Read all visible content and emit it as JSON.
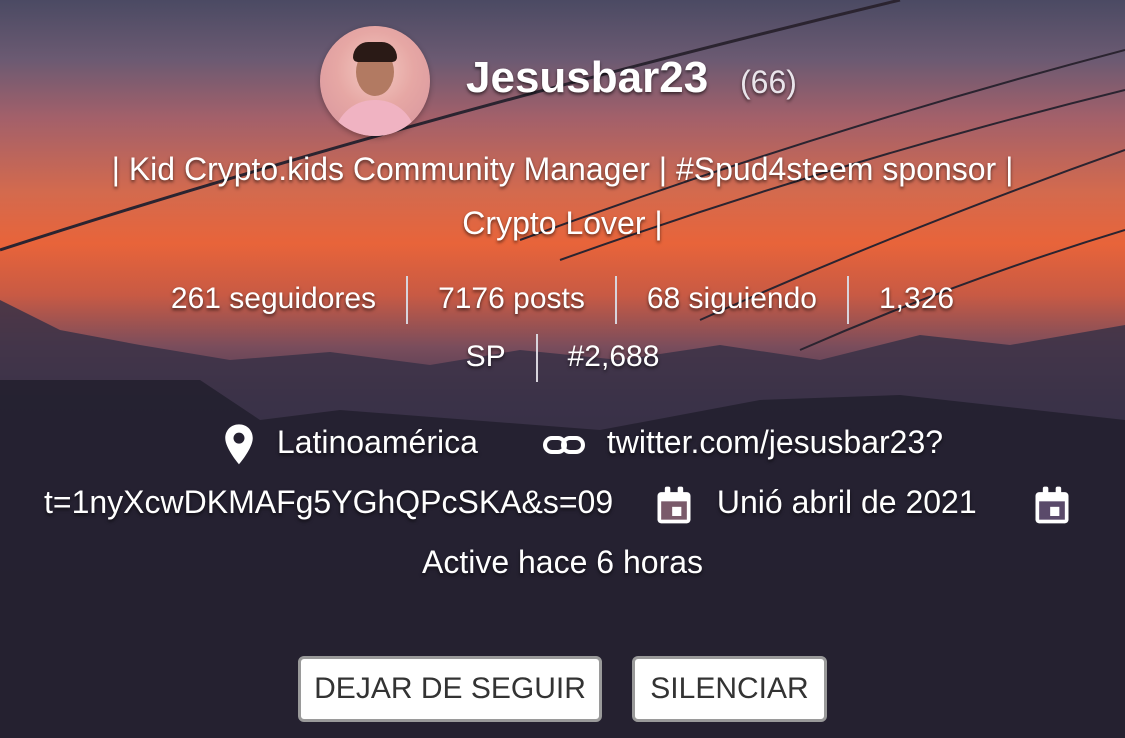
{
  "profile": {
    "username": "Jesusbar23",
    "reputation": "(66)",
    "about_line1": "| Kid Crypto.kids Community Manager | #Spud4steem sponsor |",
    "about_line2": "Crypto Lover |"
  },
  "stats": {
    "followers": "261 seguidores",
    "posts": "7176 posts",
    "following": "68 siguiendo",
    "sp_part1": "1,326",
    "sp_part2": "SP",
    "rank": "#2,688"
  },
  "info": {
    "location": "Latinoamérica",
    "website_part1": "twitter.com/jesusbar23?",
    "website_part2": "t=1nyXcwDKMAFg5YGhQPcSKA&s=09",
    "joined": "Unió abril de 2021",
    "active": "Active hace 6 horas",
    "location_icon": "map-pin-icon",
    "link_icon": "link-icon",
    "calendar_icon": "calendar-icon"
  },
  "actions": {
    "unfollow": "DEJAR DE SEGUIR",
    "mute": "SILENCIAR"
  },
  "colors": {
    "sky_top": "#4b4a63",
    "sunset": "#e8643a",
    "ground": "#1e1b2e",
    "button_bg": "#ffffff",
    "button_border": "#9a9a9a"
  }
}
